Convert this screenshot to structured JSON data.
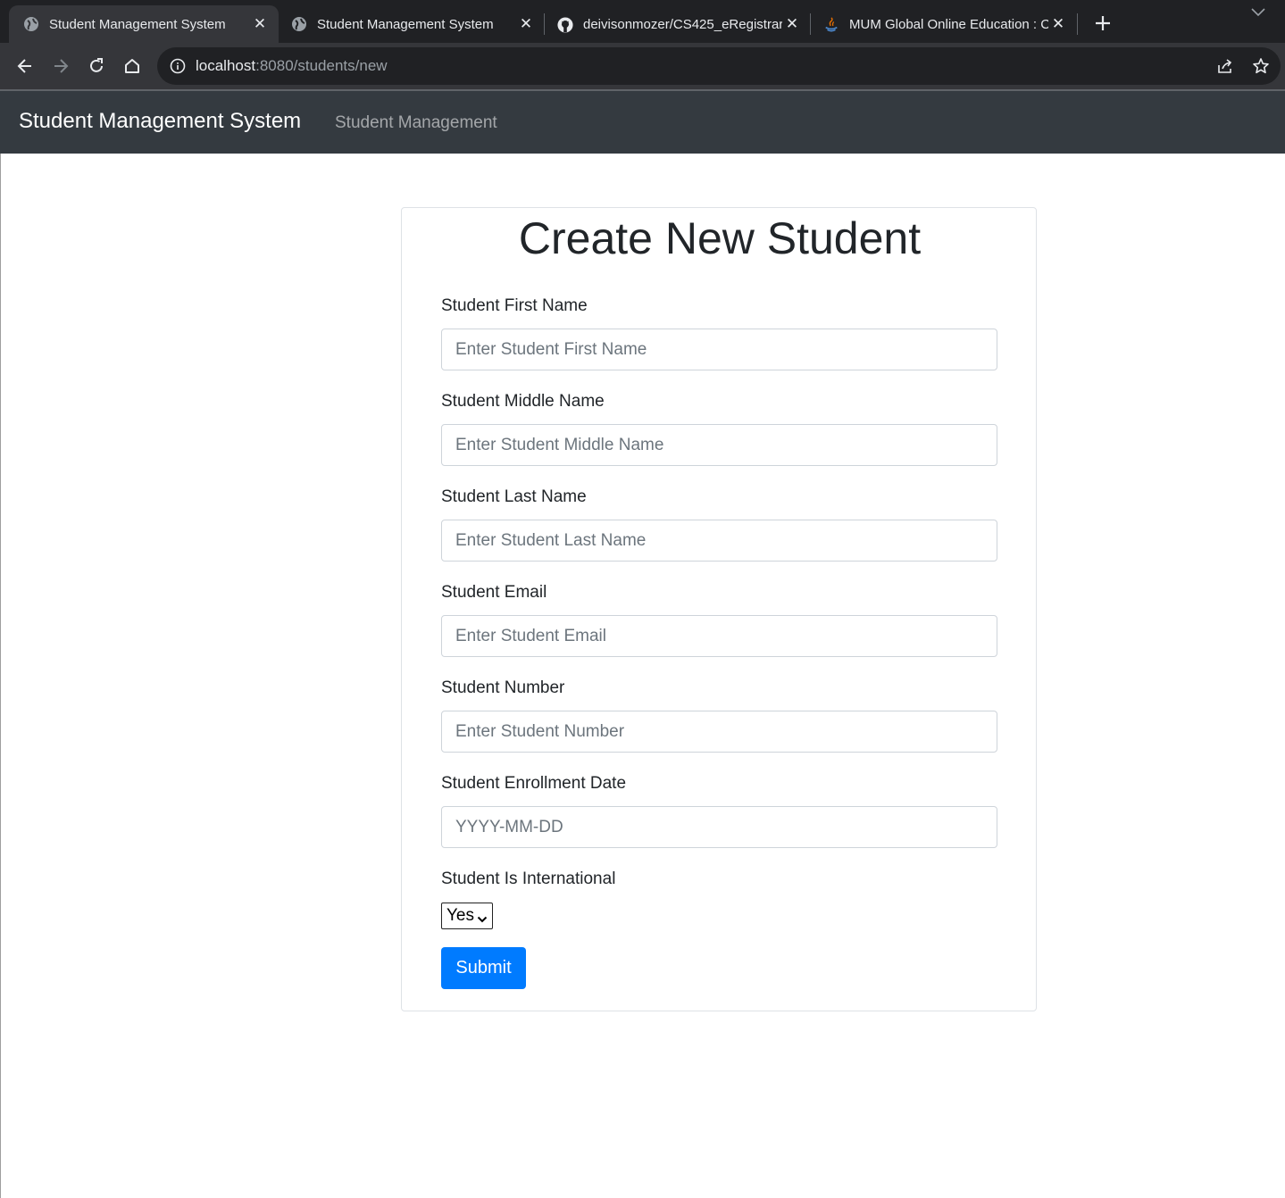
{
  "browser": {
    "tabs": [
      {
        "title": "Student Management System",
        "active": true,
        "favicon": "globe-icon"
      },
      {
        "title": "Student Management System",
        "active": false,
        "favicon": "globe-icon"
      },
      {
        "title": "deivisonmozer/CS425_eRegistrar",
        "active": false,
        "favicon": "github-icon"
      },
      {
        "title": "MUM Global Online Education : C",
        "active": false,
        "favicon": "java-icon"
      }
    ],
    "address": {
      "host": "localhost",
      "rest": ":8080/students/new"
    }
  },
  "navbar": {
    "brand": "Student Management System",
    "link": "Student Management"
  },
  "form": {
    "title": "Create New Student",
    "fields": [
      {
        "label": "Student First Name",
        "placeholder": "Enter Student First Name"
      },
      {
        "label": "Student Middle Name",
        "placeholder": "Enter Student Middle Name"
      },
      {
        "label": "Student Last Name",
        "placeholder": "Enter Student Last Name"
      },
      {
        "label": "Student Email",
        "placeholder": "Enter Student Email"
      },
      {
        "label": "Student Number",
        "placeholder": "Enter Student Number"
      },
      {
        "label": "Student Enrollment Date",
        "placeholder": "YYYY-MM-DD"
      }
    ],
    "international": {
      "label": "Student Is International",
      "selected": "Yes"
    },
    "submit_label": "Submit"
  },
  "colors": {
    "primary": "#007bff",
    "navbar_bg": "#343a40",
    "chrome_bg": "#202124"
  }
}
